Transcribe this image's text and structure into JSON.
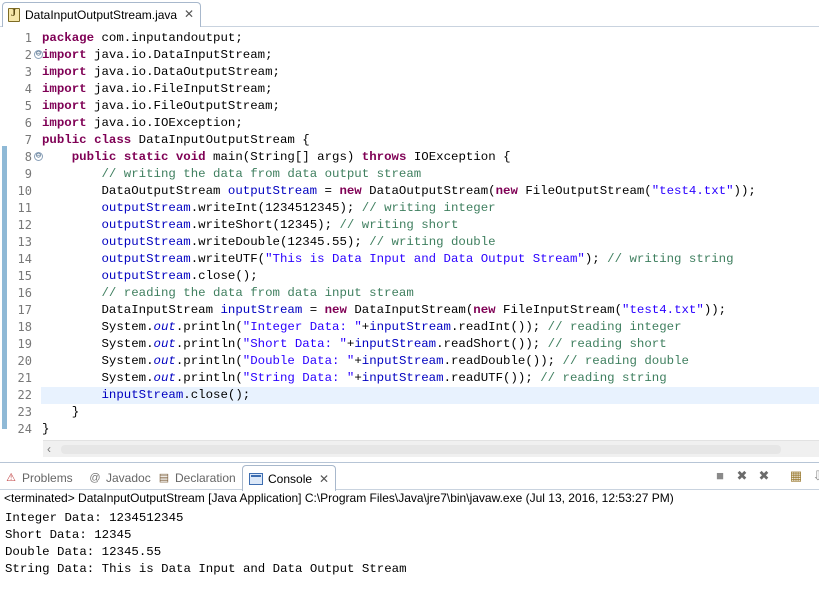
{
  "editor": {
    "tab_title": "DataInputOutputStream.java",
    "tab_close_glyph": "✕",
    "lines": [
      {
        "no": "1",
        "fold": "",
        "tokens": [
          [
            "kw",
            "package"
          ],
          [
            "t",
            " com.inputandoutput;"
          ]
        ]
      },
      {
        "no": "2",
        "fold": "⊖",
        "tokens": [
          [
            "kw",
            "import"
          ],
          [
            "t",
            " java.io.DataInputStream;"
          ]
        ]
      },
      {
        "no": "3",
        "fold": "",
        "tokens": [
          [
            "kw",
            "import"
          ],
          [
            "t",
            " java.io.DataOutputStream;"
          ]
        ]
      },
      {
        "no": "4",
        "fold": "",
        "tokens": [
          [
            "kw",
            "import"
          ],
          [
            "t",
            " java.io.FileInputStream;"
          ]
        ]
      },
      {
        "no": "5",
        "fold": "",
        "tokens": [
          [
            "kw",
            "import"
          ],
          [
            "t",
            " java.io.FileOutputStream;"
          ]
        ]
      },
      {
        "no": "6",
        "fold": "",
        "tokens": [
          [
            "kw",
            "import"
          ],
          [
            "t",
            " java.io.IOException;"
          ]
        ]
      },
      {
        "no": "7",
        "fold": "",
        "tokens": [
          [
            "kw",
            "public"
          ],
          [
            "t",
            " "
          ],
          [
            "kw",
            "class"
          ],
          [
            "t",
            " DataInputOutputStream {"
          ]
        ]
      },
      {
        "no": "8",
        "fold": "⊖",
        "tokens": [
          [
            "t",
            "    "
          ],
          [
            "kw",
            "public"
          ],
          [
            "t",
            " "
          ],
          [
            "kw",
            "static"
          ],
          [
            "t",
            " "
          ],
          [
            "kw",
            "void"
          ],
          [
            "t",
            " main(String[] args) "
          ],
          [
            "kw",
            "throws"
          ],
          [
            "t",
            " IOException {"
          ]
        ]
      },
      {
        "no": "9",
        "fold": "",
        "tokens": [
          [
            "t",
            "        "
          ],
          [
            "cmt",
            "// writing the data from data output stream"
          ]
        ]
      },
      {
        "no": "10",
        "fold": "",
        "tokens": [
          [
            "t",
            "        DataOutputStream "
          ],
          [
            "fld",
            "outputStream"
          ],
          [
            "t",
            " = "
          ],
          [
            "kw",
            "new"
          ],
          [
            "t",
            " DataOutputStream("
          ],
          [
            "kw",
            "new"
          ],
          [
            "t",
            " FileOutputStream("
          ],
          [
            "str",
            "\"test4.txt\""
          ],
          [
            "t",
            "));"
          ]
        ]
      },
      {
        "no": "11",
        "fold": "",
        "tokens": [
          [
            "t",
            "        "
          ],
          [
            "fld",
            "outputStream"
          ],
          [
            "t",
            ".writeInt(1234512345); "
          ],
          [
            "cmt",
            "// writing integer"
          ]
        ]
      },
      {
        "no": "12",
        "fold": "",
        "tokens": [
          [
            "t",
            "        "
          ],
          [
            "fld",
            "outputStream"
          ],
          [
            "t",
            ".writeShort(12345); "
          ],
          [
            "cmt",
            "// writing short"
          ]
        ]
      },
      {
        "no": "13",
        "fold": "",
        "tokens": [
          [
            "t",
            "        "
          ],
          [
            "fld",
            "outputStream"
          ],
          [
            "t",
            ".writeDouble(12345.55); "
          ],
          [
            "cmt",
            "// writing double"
          ]
        ]
      },
      {
        "no": "14",
        "fold": "",
        "tokens": [
          [
            "t",
            "        "
          ],
          [
            "fld",
            "outputStream"
          ],
          [
            "t",
            ".writeUTF("
          ],
          [
            "str",
            "\"This is Data Input and Data Output Stream\""
          ],
          [
            "t",
            "); "
          ],
          [
            "cmt",
            "// writing string"
          ]
        ]
      },
      {
        "no": "15",
        "fold": "",
        "tokens": [
          [
            "t",
            "        "
          ],
          [
            "fld",
            "outputStream"
          ],
          [
            "t",
            ".close();"
          ]
        ]
      },
      {
        "no": "16",
        "fold": "",
        "tokens": [
          [
            "t",
            "        "
          ],
          [
            "cmt",
            "// reading the data from data input stream"
          ]
        ]
      },
      {
        "no": "17",
        "fold": "",
        "tokens": [
          [
            "t",
            "        DataInputStream "
          ],
          [
            "fld",
            "inputStream"
          ],
          [
            "t",
            " = "
          ],
          [
            "kw",
            "new"
          ],
          [
            "t",
            " DataInputStream("
          ],
          [
            "kw",
            "new"
          ],
          [
            "t",
            " FileInputStream("
          ],
          [
            "str",
            "\"test4.txt\""
          ],
          [
            "t",
            "));"
          ]
        ]
      },
      {
        "no": "18",
        "fold": "",
        "tokens": [
          [
            "t",
            "        System."
          ],
          [
            "sfld",
            "out"
          ],
          [
            "t",
            ".println("
          ],
          [
            "str",
            "\"Integer Data: \""
          ],
          [
            "t",
            "+"
          ],
          [
            "fld",
            "inputStream"
          ],
          [
            "t",
            ".readInt()); "
          ],
          [
            "cmt",
            "// reading integer"
          ]
        ]
      },
      {
        "no": "19",
        "fold": "",
        "tokens": [
          [
            "t",
            "        System."
          ],
          [
            "sfld",
            "out"
          ],
          [
            "t",
            ".println("
          ],
          [
            "str",
            "\"Short Data: \""
          ],
          [
            "t",
            "+"
          ],
          [
            "fld",
            "inputStream"
          ],
          [
            "t",
            ".readShort()); "
          ],
          [
            "cmt",
            "// reading short"
          ]
        ]
      },
      {
        "no": "20",
        "fold": "",
        "tokens": [
          [
            "t",
            "        System."
          ],
          [
            "sfld",
            "out"
          ],
          [
            "t",
            ".println("
          ],
          [
            "str",
            "\"Double Data: \""
          ],
          [
            "t",
            "+"
          ],
          [
            "fld",
            "inputStream"
          ],
          [
            "t",
            ".readDouble()); "
          ],
          [
            "cmt",
            "// reading double"
          ]
        ]
      },
      {
        "no": "21",
        "fold": "",
        "tokens": [
          [
            "t",
            "        System."
          ],
          [
            "sfld",
            "out"
          ],
          [
            "t",
            ".println("
          ],
          [
            "str",
            "\"String Data: \""
          ],
          [
            "t",
            "+"
          ],
          [
            "fld",
            "inputStream"
          ],
          [
            "t",
            ".readUTF()); "
          ],
          [
            "cmt",
            "// reading string"
          ]
        ]
      },
      {
        "no": "22",
        "fold": "",
        "current": true,
        "tokens": [
          [
            "t",
            "        "
          ],
          [
            "fld",
            "inputStream"
          ],
          [
            "t",
            ".close();"
          ]
        ]
      },
      {
        "no": "23",
        "fold": "",
        "tokens": [
          [
            "t",
            "    }"
          ]
        ]
      },
      {
        "no": "24",
        "fold": "",
        "tokens": [
          [
            "t",
            "}"
          ]
        ]
      }
    ]
  },
  "panel": {
    "tabs": [
      {
        "name": "problems",
        "label": "Problems",
        "icon": "problems-icon",
        "glyph": "⚠"
      },
      {
        "name": "javadoc",
        "label": "Javadoc",
        "icon": "javadoc-icon",
        "glyph": "@"
      },
      {
        "name": "declaration",
        "label": "Declaration",
        "icon": "declaration-icon",
        "glyph": "▤"
      },
      {
        "name": "console",
        "label": "Console",
        "icon": "console-icon",
        "active": true
      }
    ],
    "toolbar": [
      {
        "name": "terminate-icon",
        "glyph": "■"
      },
      {
        "name": "remove-launch-icon",
        "glyph": "✖"
      },
      {
        "name": "remove-all-terminated-icon",
        "glyph": "✖"
      },
      {
        "name": "clear-console-icon",
        "glyph": "▦"
      },
      {
        "name": "scroll-lock-icon",
        "glyph": "⇩"
      }
    ],
    "console_header": "<terminated> DataInputOutputStream [Java Application] C:\\Program Files\\Java\\jre7\\bin\\javaw.exe (Jul 13, 2016, 12:53:27 PM)",
    "output": [
      "Integer Data: 1234512345",
      "Short Data: 12345",
      "Double Data: 12345.55",
      "String Data: This is Data Input and Data Output Stream"
    ]
  },
  "colors": {
    "keyword": "#7f0055",
    "string": "#2a00ff",
    "comment": "#3f7f5f",
    "field": "#0000c0",
    "current_line": "#e8f2fe",
    "change_marker": "#8fb9d6"
  }
}
